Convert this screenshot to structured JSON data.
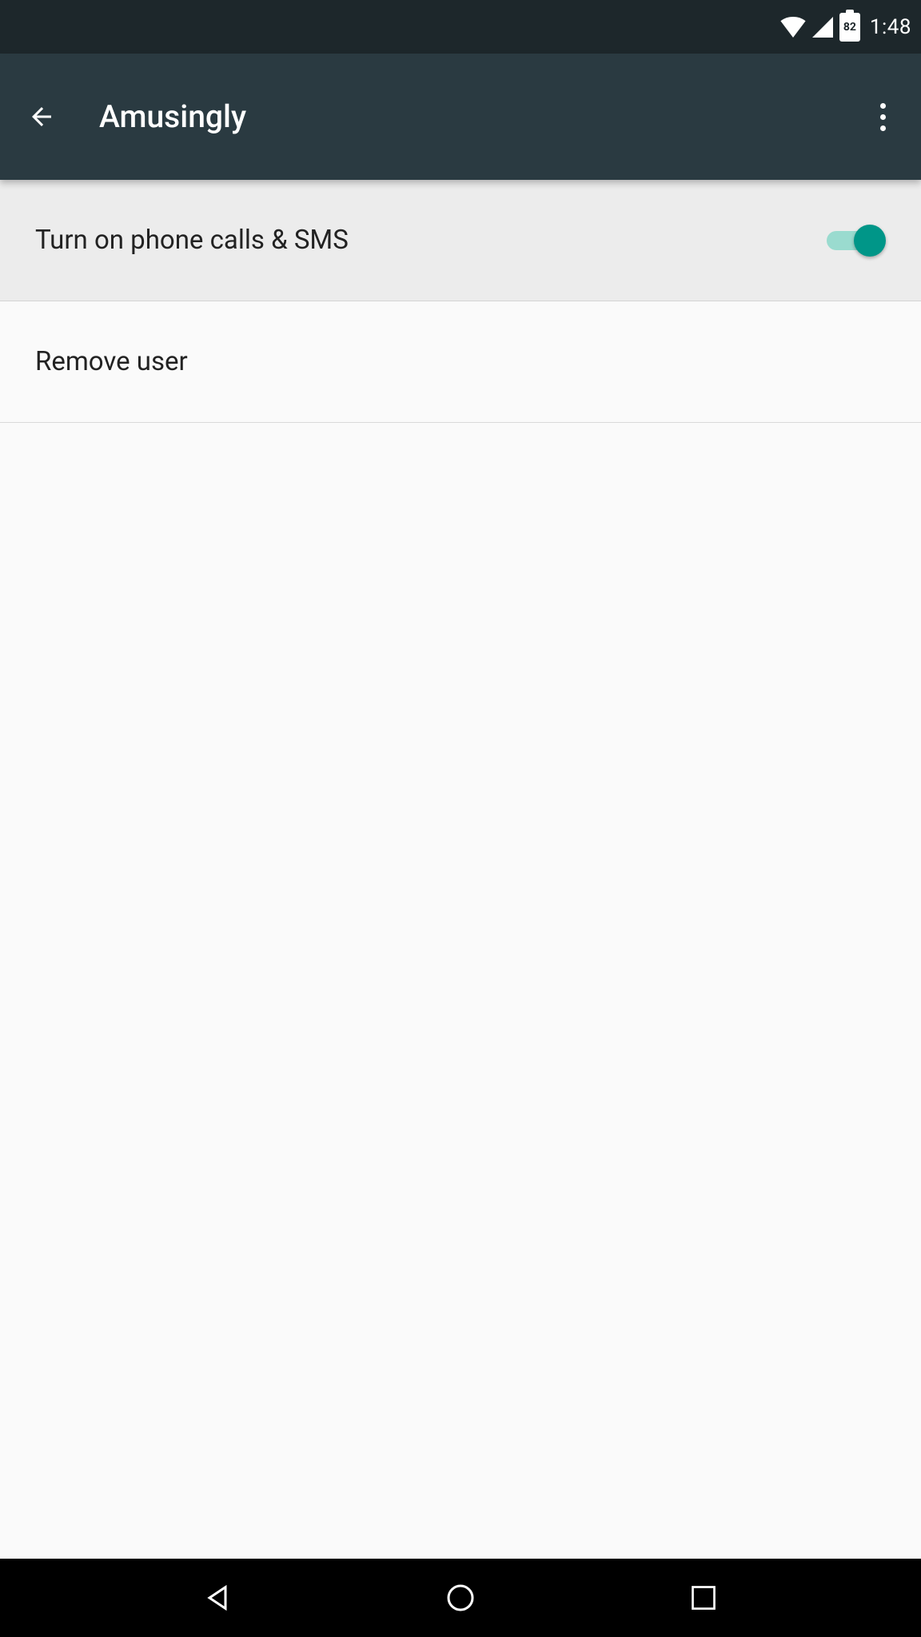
{
  "status_bar": {
    "battery_level": "82",
    "time": "1:48"
  },
  "app_bar": {
    "title": "Amusingly"
  },
  "settings": {
    "toggle_row": {
      "label": "Turn on phone calls & SMS",
      "enabled": true
    },
    "remove_row": {
      "label": "Remove user"
    }
  },
  "colors": {
    "status_bg": "#1d272b",
    "appbar_bg": "#2a3a41",
    "accent": "#009688",
    "track": "#9adbcf",
    "row_highlight": "#ececec",
    "content_bg": "#fafafa"
  }
}
